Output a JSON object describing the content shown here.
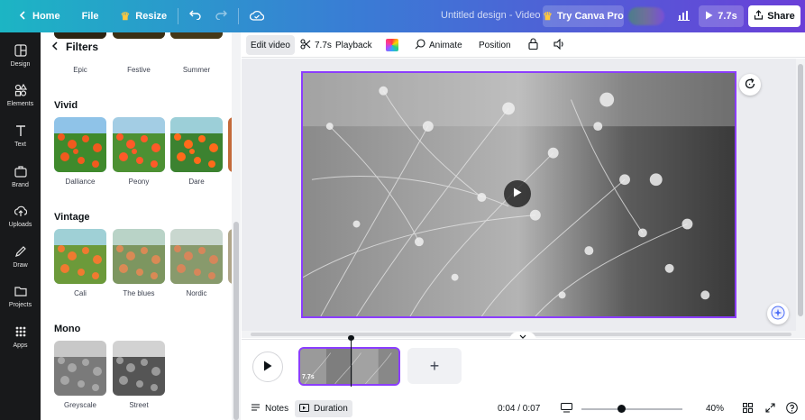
{
  "topbar": {
    "home_label": "Home",
    "file_label": "File",
    "resize_label": "Resize",
    "title": "Untitled design - Video",
    "try_pro_label": "Try Canva Pro",
    "play_duration": "7.7s",
    "share_label": "Share"
  },
  "rail": {
    "items": [
      {
        "label": "Design",
        "icon": "layout-icon"
      },
      {
        "label": "Elements",
        "icon": "shapes-icon"
      },
      {
        "label": "Text",
        "icon": "text-icon"
      },
      {
        "label": "Brand",
        "icon": "briefcase-icon"
      },
      {
        "label": "Uploads",
        "icon": "cloud-upload-icon"
      },
      {
        "label": "Draw",
        "icon": "pen-icon"
      },
      {
        "label": "Projects",
        "icon": "folder-icon"
      },
      {
        "label": "Apps",
        "icon": "grid-icon"
      }
    ]
  },
  "panel": {
    "title": "Filters",
    "top_row": [
      "Epic",
      "Festive",
      "Summer"
    ],
    "sections": [
      {
        "title": "Vivid",
        "items": [
          "Dalliance",
          "Peony",
          "Dare"
        ]
      },
      {
        "title": "Vintage",
        "items": [
          "Cali",
          "The blues",
          "Nordic"
        ]
      },
      {
        "title": "Mono",
        "items": [
          "Greyscale",
          "Street"
        ]
      }
    ]
  },
  "toolbar": {
    "edit_video": "Edit video",
    "trim_duration": "7.7s",
    "playback": "Playback",
    "animate": "Animate",
    "position": "Position"
  },
  "timeline": {
    "clip_duration": "7.7s",
    "add_label": "+"
  },
  "bottombar": {
    "notes": "Notes",
    "duration": "Duration",
    "time": "0:04 / 0:07",
    "zoom": "40%",
    "zoom_level": 0.4
  },
  "colors": {
    "accent": "#8b3dff",
    "topbar_start": "#1cb5c4",
    "topbar_end": "#6a3fd8",
    "rail_bg": "#18191b"
  }
}
